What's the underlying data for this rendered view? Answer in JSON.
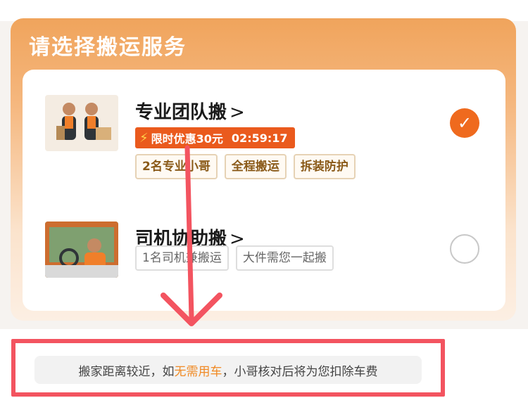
{
  "panel": {
    "title": "请选择搬运服务"
  },
  "options": [
    {
      "title": "专业团队搬",
      "chevron": ">",
      "selected": true,
      "promo": {
        "label": "限时优惠30元",
        "countdown": "02:59:17"
      },
      "tags": [
        "2名专业小哥",
        "全程搬运",
        "拆装防护"
      ]
    },
    {
      "title": "司机协助搬",
      "chevron": ">",
      "selected": false,
      "tags": [
        "1名司机兼搬运",
        "大件需您一起搬"
      ]
    }
  ],
  "note": {
    "before": "搬家距离较近，如",
    "highlight": "无需用车",
    "after": "，小哥核对后将为您扣除车费"
  },
  "icons": {
    "promo": "lightning-icon",
    "selected": "check-icon",
    "chevron": "chevron-right-icon"
  },
  "colors": {
    "accent": "#ef6a1e",
    "promo_bg": "#ea5a1d",
    "highlight_text": "#f08a25",
    "annotation": "#f35460"
  }
}
